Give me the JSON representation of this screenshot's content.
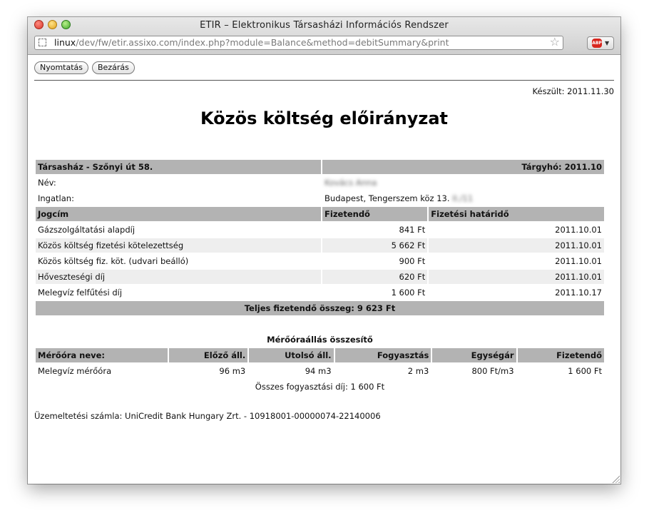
{
  "window": {
    "title": "ETIR – Elektronikus Társasházi Információs Rendszer"
  },
  "address_bar": {
    "host": "linux",
    "path": "/dev/fw/etir.assixo.com/index.php?module=Balance&method=debitSummary&print"
  },
  "toolbar": {
    "print_label": "Nyomtatás",
    "close_label": "Bezárás"
  },
  "meta": {
    "created": "Készült: 2011.11.30"
  },
  "doc_title": "Közös költség előirányzat",
  "header": {
    "house": "Társasház - Szőnyi út 58.",
    "month": "Tárgyhó: 2011.10",
    "name_label": "Név:",
    "name_value": "Kovács Anna",
    "property_label": "Ingatlan:",
    "property_value": "Budapest, Tengerszem köz 13.",
    "property_unit": "II./11"
  },
  "charges": {
    "columns": [
      "Jogcím",
      "Fizetendő",
      "Fizetési határidő"
    ],
    "rows": [
      {
        "title": "Gázszolgáltatási alapdíj",
        "amount": "841 Ft",
        "due": "2011.10.01"
      },
      {
        "title": "Közös költség fizetési kötelezettség",
        "amount": "5 662 Ft",
        "due": "2011.10.01"
      },
      {
        "title": "Közös költség fiz. köt. (udvari beálló)",
        "amount": "900 Ft",
        "due": "2011.10.01"
      },
      {
        "title": "Hőveszteségi díj",
        "amount": "620 Ft",
        "due": "2011.10.01"
      },
      {
        "title": "Melegvíz felfűtési díj",
        "amount": "1 600 Ft",
        "due": "2011.10.17"
      }
    ],
    "total": "Teljes fizetendő összeg: 9 623 Ft"
  },
  "meters": {
    "title": "Mérőóraállás összesítő",
    "columns": [
      "Mérőóra neve:",
      "Előző áll.",
      "Utolsó áll.",
      "Fogyasztás",
      "Egységár",
      "Fizetendő"
    ],
    "rows": [
      {
        "name": "Melegvíz mérőóra",
        "prev": "96 m3",
        "last": "94 m3",
        "usage": "2 m3",
        "unit_price": "800 Ft/m3",
        "amount": "1 600 Ft"
      }
    ],
    "total": "Összes fogyasztási díj: 1 600 Ft"
  },
  "footer": {
    "account": "Üzemeltetési számla: UniCredit Bank Hungary Zrt. - 10918001-00000074-22140006"
  }
}
